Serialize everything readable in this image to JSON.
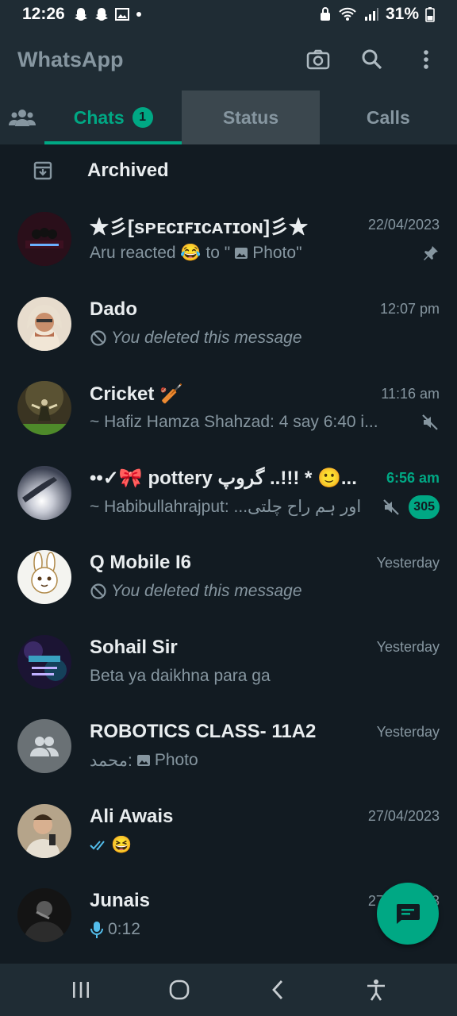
{
  "status_bar": {
    "time": "12:26",
    "battery": "31%"
  },
  "header": {
    "title": "WhatsApp"
  },
  "tabs": [
    {
      "label": "Chats",
      "badge": "1"
    },
    {
      "label": "Status"
    },
    {
      "label": "Calls"
    }
  ],
  "archived": {
    "label": "Archived"
  },
  "chats": [
    {
      "name": "★彡[ѕᴘᴇᴄɪꜰɪᴄᴀᴛɪᴏɴ]彡★",
      "time": "22/04/2023",
      "msg_prefix": "Aru reacted 😂 to \"",
      "msg_suffix": "Photo\"",
      "pinned": true,
      "avatar_color": "#2a0f1a"
    },
    {
      "name": "Dado",
      "time": "12:07 pm",
      "message": "You deleted this message",
      "avatar_color": "#d8c6ae"
    },
    {
      "name": "Cricket 🏏",
      "time": "11:16 am",
      "message": "~ Hafiz Hamza Shahzad: 4 say 6:40 i...",
      "muted": true,
      "avatar_color": "#4a4530"
    },
    {
      "name": "••✓🎀 pottery گروپ ..!!! * 🙂...",
      "time": "6:56 am",
      "message": "~ Habibullahrajput: ...اور ہم راح چلتی",
      "muted": true,
      "unread": "305",
      "avatar_color": "#5b6170"
    },
    {
      "name": "Q Mobile I6",
      "time": "Yesterday",
      "message": "You deleted this message",
      "avatar_color": "#f2f2f2"
    },
    {
      "name": "Sohail Sir",
      "time": "Yesterday",
      "message": "Beta ya daikhna para ga",
      "avatar_color": "#1b1433"
    },
    {
      "name": "ROBOTICS CLASS- 11A2",
      "time": "Yesterday",
      "msg_prefix": "محمد:",
      "msg_suffix": "Photo",
      "avatar_color": "#6a7175"
    },
    {
      "name": "Ali Awais",
      "time": "27/04/2023",
      "message": "😆",
      "avatar_color": "#8e7a64"
    },
    {
      "name": "Junais",
      "time": "27/04/2023",
      "message": "0:12",
      "avatar_color": "#1a1a1a"
    }
  ],
  "colors": {
    "accent": "#00a884",
    "background": "#121b22",
    "surface": "#1f2c34",
    "muted_text": "#8696a0"
  }
}
